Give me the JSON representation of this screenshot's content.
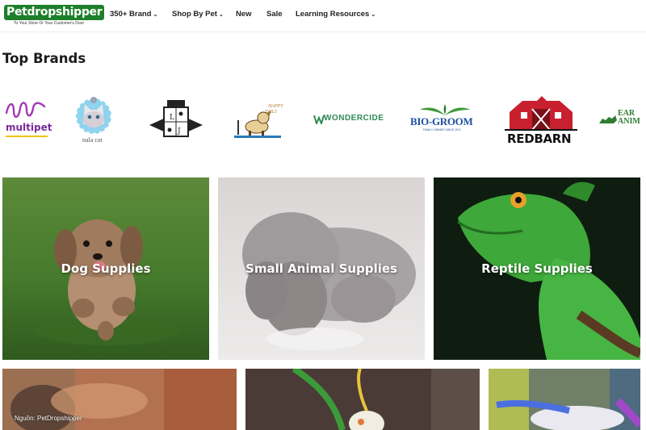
{
  "logo": {
    "name": "Petdropshipper",
    "tagline": "To Your Store Or Your Customer's Door"
  },
  "nav": [
    {
      "label": "350+ Brand",
      "has_dropdown": true
    },
    {
      "label": "Shop By Pet",
      "has_dropdown": true
    },
    {
      "label": "New",
      "has_dropdown": false
    },
    {
      "label": "Sale",
      "has_dropdown": false
    },
    {
      "label": "Learning Resources",
      "has_dropdown": true
    }
  ],
  "chevron": "⌄",
  "section_title": "Top Brands",
  "brands": [
    {
      "name": "multipet",
      "icon": "multipet-logo"
    },
    {
      "name": "nala cat",
      "icon": "nala-cat-logo"
    },
    {
      "name": "Lord Jameson",
      "icon": "lord-jameson-logo"
    },
    {
      "name": "Happy Tails",
      "icon": "happy-dog-logo"
    },
    {
      "name": "WONDERCIDE",
      "icon": "wondercide-logo"
    },
    {
      "name": "BIO-GROOM",
      "tagline": "FAMILY OWNED SINCE 1971",
      "icon": "bio-groom-logo"
    },
    {
      "name": "REDBARN",
      "icon": "redbarn-logo"
    },
    {
      "name": "EARTH ANIMAL",
      "display_fragments": [
        "EAR",
        "ANIM"
      ],
      "icon": "earth-animal-logo"
    }
  ],
  "categories": [
    {
      "label": "Dog Supplies",
      "image": "dog-photo"
    },
    {
      "label": "Small Animal Supplies",
      "image": "rabbit-photo"
    },
    {
      "label": "Reptile Supplies",
      "image": "lizard-photo"
    },
    {
      "label": "",
      "image": "cat-photo"
    },
    {
      "label": "",
      "image": "bird-photo"
    },
    {
      "label": "",
      "image": "fish-photo"
    }
  ],
  "credit": "Nguồn: PetDropshipper",
  "colors": {
    "brand_green": "#1e7f2a",
    "wondercide_green": "#2e8b57",
    "biogroom_blue": "#1e4fa0",
    "redbarn_red": "#c8202e"
  }
}
